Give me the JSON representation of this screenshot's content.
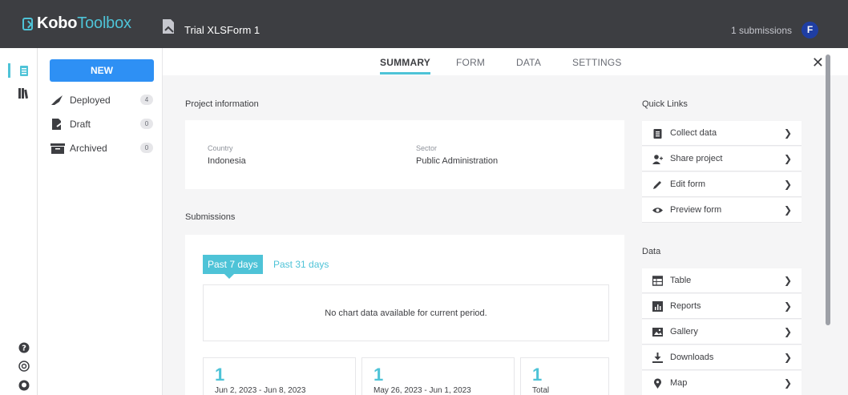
{
  "header": {
    "logo_kobo": "Kobo",
    "logo_toolbox": "Toolbox",
    "project_title": "Trial XLSForm 1",
    "submissions_count": "1 submissions",
    "avatar_initial": "F"
  },
  "sidebar": {
    "new_button": "NEW",
    "items": [
      {
        "label": "Deployed",
        "count": "4",
        "icon": "rocket-icon"
      },
      {
        "label": "Draft",
        "count": "0",
        "icon": "draft-icon"
      },
      {
        "label": "Archived",
        "count": "0",
        "icon": "archive-icon"
      }
    ]
  },
  "tabs": [
    {
      "label": "SUMMARY",
      "active": true
    },
    {
      "label": "FORM",
      "active": false
    },
    {
      "label": "DATA",
      "active": false
    },
    {
      "label": "SETTINGS",
      "active": false
    }
  ],
  "project_info": {
    "title": "Project information",
    "country_label": "Country",
    "country_value": "Indonesia",
    "sector_label": "Sector",
    "sector_value": "Public Administration"
  },
  "submissions": {
    "title": "Submissions",
    "period_active": "Past 7 days",
    "period_inactive": "Past 31 days",
    "no_data": "No chart data available for current period.",
    "stats": [
      {
        "num": "1",
        "range": "Jun 2, 2023 - Jun 8, 2023"
      },
      {
        "num": "1",
        "range": "May 26, 2023 - Jun 1, 2023"
      },
      {
        "num": "1",
        "range": "Total"
      }
    ]
  },
  "quick_links": {
    "title": "Quick Links",
    "items": [
      {
        "label": "Collect data",
        "icon": "clipboard-icon"
      },
      {
        "label": "Share project",
        "icon": "add-user-icon"
      },
      {
        "label": "Edit form",
        "icon": "pencil-icon"
      },
      {
        "label": "Preview form",
        "icon": "eye-icon"
      }
    ]
  },
  "data_links": {
    "title": "Data",
    "items": [
      {
        "label": "Table",
        "icon": "table-icon"
      },
      {
        "label": "Reports",
        "icon": "reports-icon"
      },
      {
        "label": "Gallery",
        "icon": "gallery-icon"
      },
      {
        "label": "Downloads",
        "icon": "download-icon"
      },
      {
        "label": "Map",
        "icon": "map-pin-icon"
      }
    ]
  },
  "colors": {
    "header_bg": "#3d3e42",
    "accent_teal": "#4ec3d7",
    "button_blue": "#2e90f4",
    "avatar_blue": "#1f3ea3"
  }
}
